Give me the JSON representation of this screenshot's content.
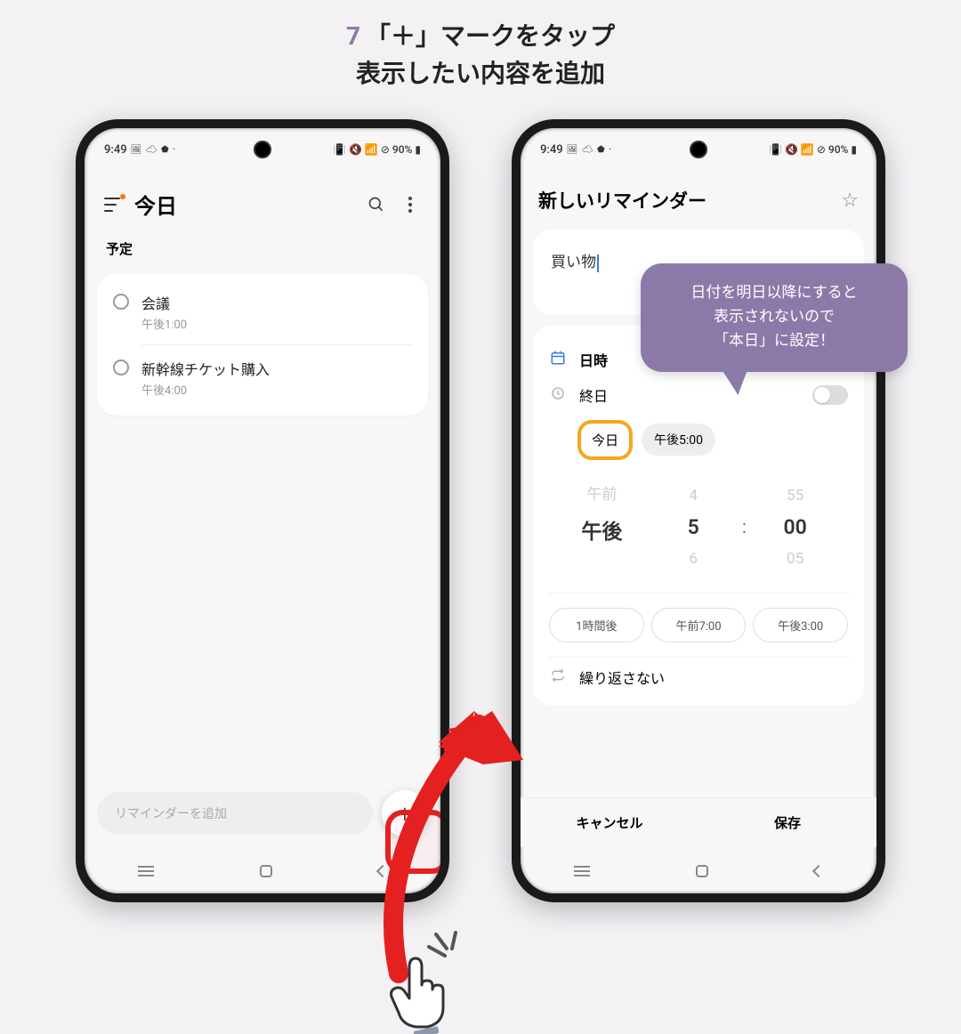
{
  "instruction": {
    "step": "7",
    "line1": "「＋」マークをタップ",
    "line2": "表示したい内容を追加"
  },
  "status": {
    "time": "9:49",
    "icons_left": "🖼 ☁ ⬟ ·",
    "battery": "90%",
    "icons_right": "🔇 📶 ⊘"
  },
  "phone1": {
    "title": "今日",
    "section": "予定",
    "items": [
      {
        "title": "会議",
        "time": "午後1:00"
      },
      {
        "title": "新幹線チケット購入",
        "time": "午後4:00"
      }
    ],
    "input_placeholder": "リマインダーを追加",
    "add_symbol": "+"
  },
  "phone2": {
    "title": "新しいリマインダー",
    "input_text": "買い物",
    "datetime_label": "日時",
    "allday_label": "終日",
    "today_label": "今日",
    "time_display": "午後5:00",
    "picker": {
      "ampm_prev": "午前",
      "ampm_sel": "午後",
      "hour_prev": "4",
      "hour_sel": "5",
      "hour_next": "6",
      "min_prev": "55",
      "min_sel": "00",
      "min_next": "05"
    },
    "chips": [
      "1時間後",
      "午前7:00",
      "午後3:00"
    ],
    "repeat_label": "繰り返さない",
    "cancel": "キャンセル",
    "save": "保存"
  },
  "bubble": {
    "line1": "日付を明日以降にすると",
    "line2": "表示されないので",
    "line3": "「本日」に設定！"
  }
}
